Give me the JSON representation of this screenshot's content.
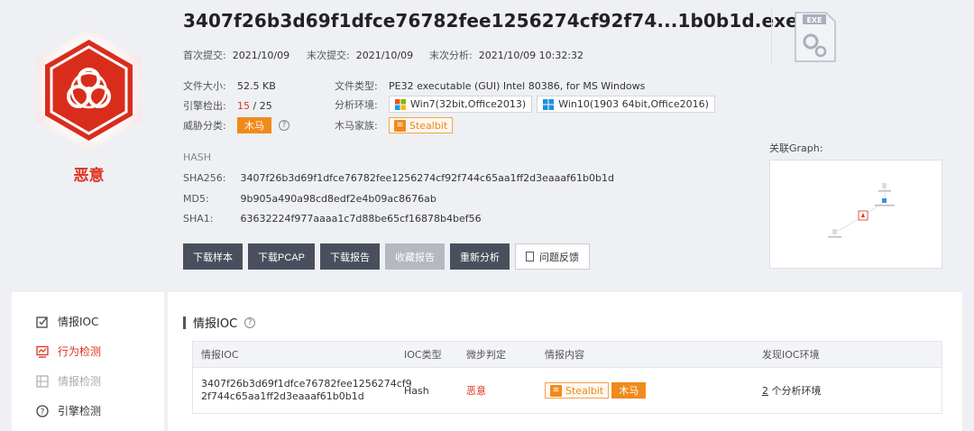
{
  "header": {
    "verdict": "恶意",
    "title": "3407f26b3d69f1dfce76782fee1256274cf92f74...1b0b1d.exe",
    "file_icon_label": "EXE",
    "first_submit_label": "首次提交:",
    "first_submit": "2021/10/09",
    "last_submit_label": "末次提交:",
    "last_submit": "2021/10/09",
    "last_analysis_label": "末次分析:",
    "last_analysis": "2021/10/09 10:32:32"
  },
  "details": {
    "file_size_label": "文件大小:",
    "file_size": "52.5 KB",
    "file_type_label": "文件类型:",
    "file_type": "PE32 executable (GUI) Intel 80386, for MS Windows",
    "engine_label": "引擎检出:",
    "engine_detected": "15",
    "engine_total": "/ 25",
    "env_label": "分析环境:",
    "env_win7": "Win7(32bit,Office2013)",
    "env_win10": "Win10(1903 64bit,Office2016)",
    "threat_label": "威胁分类:",
    "threat_value": "木马",
    "family_label": "木马家族:",
    "family_value": "Stealbit"
  },
  "hash": {
    "title": "HASH",
    "sha256_label": "SHA256:",
    "sha256": "3407f26b3d69f1dfce76782fee1256274cf92f744c65aa1ff2d3eaaaf61b0b1d",
    "md5_label": "MD5:",
    "md5": "9b905a490a98cd8edf2e4b09ac8676ab",
    "sha1_label": "SHA1:",
    "sha1": "63632224f977aaaa1c7d88be65cf16878b4bef56"
  },
  "actions": {
    "download_sample": "下载样本",
    "download_pcap": "下载PCAP",
    "download_report": "下载报告",
    "favorite_report": "收藏报告",
    "reanalyze": "重新分析",
    "feedback": "问题反馈"
  },
  "graph": {
    "label": "关联Graph:"
  },
  "sidebar": {
    "items": [
      {
        "label": "情报IOC"
      },
      {
        "label": "行为检测"
      },
      {
        "label": "情报检测"
      },
      {
        "label": "引擎检测"
      }
    ]
  },
  "ioc": {
    "title": "情报IOC",
    "columns": [
      "情报IOC",
      "IOC类型",
      "微步判定",
      "情报内容",
      "发现IOC环境"
    ],
    "row": {
      "ioc_line1": "3407f26b3d69f1dfce76782fee1256274cf9",
      "ioc_line2": "2f744c65aa1ff2d3eaaaf61b0b1d",
      "type": "Hash",
      "judgement": "恶意",
      "tag_family": "Stealbit",
      "tag_threat": "木马",
      "env_count": "2",
      "env_text": "个分析环境"
    }
  },
  "colors": {
    "malicious_red": "#e0301e",
    "tag_orange": "#f08a1d",
    "button_dark": "#4a4f5e"
  }
}
